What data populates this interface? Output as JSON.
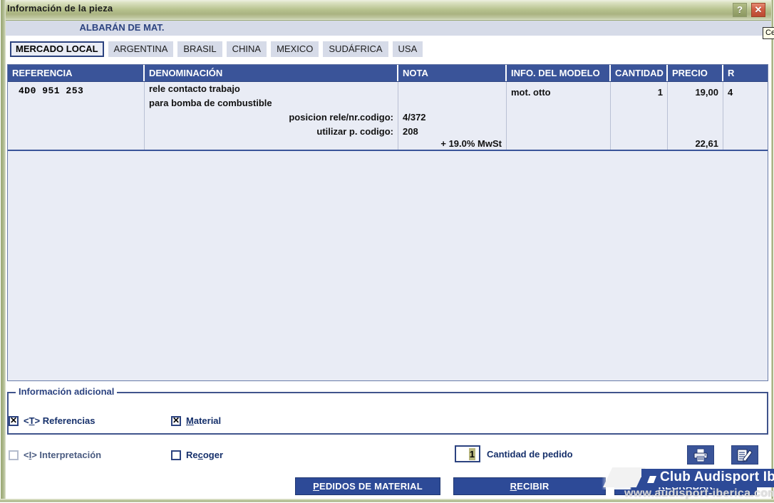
{
  "window": {
    "title": "Información de la pieza",
    "help_button": "?",
    "close_button": "✕",
    "tooltip": "Ce"
  },
  "banner": {
    "title": "ALBARÁN DE MAT."
  },
  "tabs": [
    {
      "label": "MERCADO LOCAL",
      "selected": true
    },
    {
      "label": "ARGENTINA",
      "selected": false
    },
    {
      "label": "BRASIL",
      "selected": false
    },
    {
      "label": "CHINA",
      "selected": false
    },
    {
      "label": "MEXICO",
      "selected": false
    },
    {
      "label": "SUDÁFRICA",
      "selected": false
    },
    {
      "label": "USA",
      "selected": false
    }
  ],
  "table": {
    "columns": [
      "REFERENCIA",
      "DENOMINACIÓN",
      "NOTA",
      "INFO. DEL MODELO",
      "CANTIDAD",
      "PRECIO",
      "R"
    ],
    "row": {
      "referencia": "4D0 951 253",
      "denominacion_line1": "rele contacto trabajo",
      "denominacion_line2": "para bomba de combustible",
      "detail_label_1": "posicion rele/nr.codigo:",
      "detail_value_1": "4/372",
      "detail_label_2": "utilizar p. codigo:",
      "detail_value_2": "208",
      "tax_label": "+ 19.0% MwSt",
      "info_modelo": "mot. otto",
      "cantidad": "1",
      "precio": "19,00",
      "precio_total": "22,61",
      "r": "4"
    }
  },
  "additional_info": {
    "legend": "Información adicional",
    "value": ""
  },
  "checkboxes": [
    {
      "name": "referencias",
      "prefix": "<T>",
      "label": "Referencias",
      "checked": true,
      "disabled": false,
      "underline": ""
    },
    {
      "name": "material",
      "prefix": "",
      "label": "Material",
      "checked": true,
      "disabled": false,
      "underline": "M"
    },
    {
      "name": "interpretacion",
      "prefix": "<I>",
      "label": "Interpretación",
      "checked": false,
      "disabled": true,
      "underline": ""
    },
    {
      "name": "recoger",
      "prefix": "",
      "label": "Recoger",
      "checked": false,
      "disabled": false,
      "underline": "c"
    }
  ],
  "quantity": {
    "value": "1",
    "label": "Cantidad de pedido"
  },
  "icon_buttons": [
    {
      "name": "print-icon",
      "title": "print"
    },
    {
      "name": "edit-document-icon",
      "title": "edit"
    }
  ],
  "buttons": [
    {
      "name": "pedidos-de-material",
      "label": "PEDIDOS DE MATERIAL"
    },
    {
      "name": "recibir",
      "label": "RECIBIR"
    },
    {
      "name": "regrabar",
      "label": "REGRABAR"
    }
  ],
  "watermark": {
    "brand": "Club Audisport Ibérica",
    "url": "www.audisport-iberica.com"
  },
  "colors": {
    "titlebar": "#aab381",
    "header_blue": "#3a5499",
    "button_blue": "#2d4a97",
    "grid_bg": "#e9ecf5",
    "banner_bg": "#d6dbe8",
    "accent_text": "#2c4380"
  }
}
